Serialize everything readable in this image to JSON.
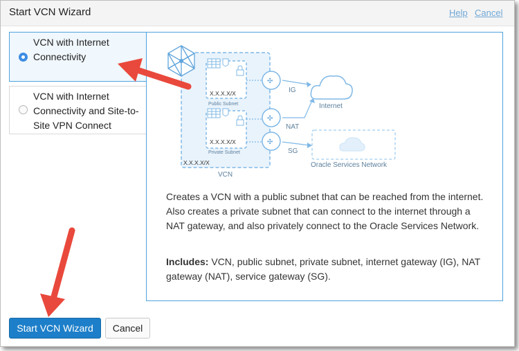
{
  "dialog": {
    "title": "Start VCN Wizard",
    "help_link": "Help",
    "cancel_link": "Cancel"
  },
  "options": [
    {
      "label": "VCN with Internet Connectivity",
      "selected": true
    },
    {
      "label": "VCN with Internet Connectivity and Site-to-Site VPN Connect",
      "selected": false
    }
  ],
  "diagram": {
    "public_cidr": "X.X.X.X/X",
    "public_subnet": "Public Subnet",
    "private_cidr": "X.X.X.X/X",
    "private_subnet": "Private Subnet",
    "vcn_cidr": "X.X.X.X/X",
    "vcn": "VCN",
    "ig": "IG",
    "nat": "NAT",
    "sg": "SG",
    "internet": "Internet",
    "osn": "Oracle Services Network"
  },
  "description": "Creates a VCN with a public subnet that can be reached from the internet. Also creates a private subnet that can connect to the internet through a NAT gateway, and also privately connect to the Oracle Services Network.",
  "includes": {
    "label": "Includes:",
    "text": " VCN, public subnet, private subnet, internet gateway (IG), NAT gateway (NAT), service gateway (SG)."
  },
  "footer": {
    "primary_button": "Start VCN Wizard",
    "cancel_button": "Cancel"
  },
  "colors": {
    "accent": "#1d7fc9",
    "diagram_blue": "#7fb8e6",
    "annotation_arrow": "#e9493c"
  }
}
